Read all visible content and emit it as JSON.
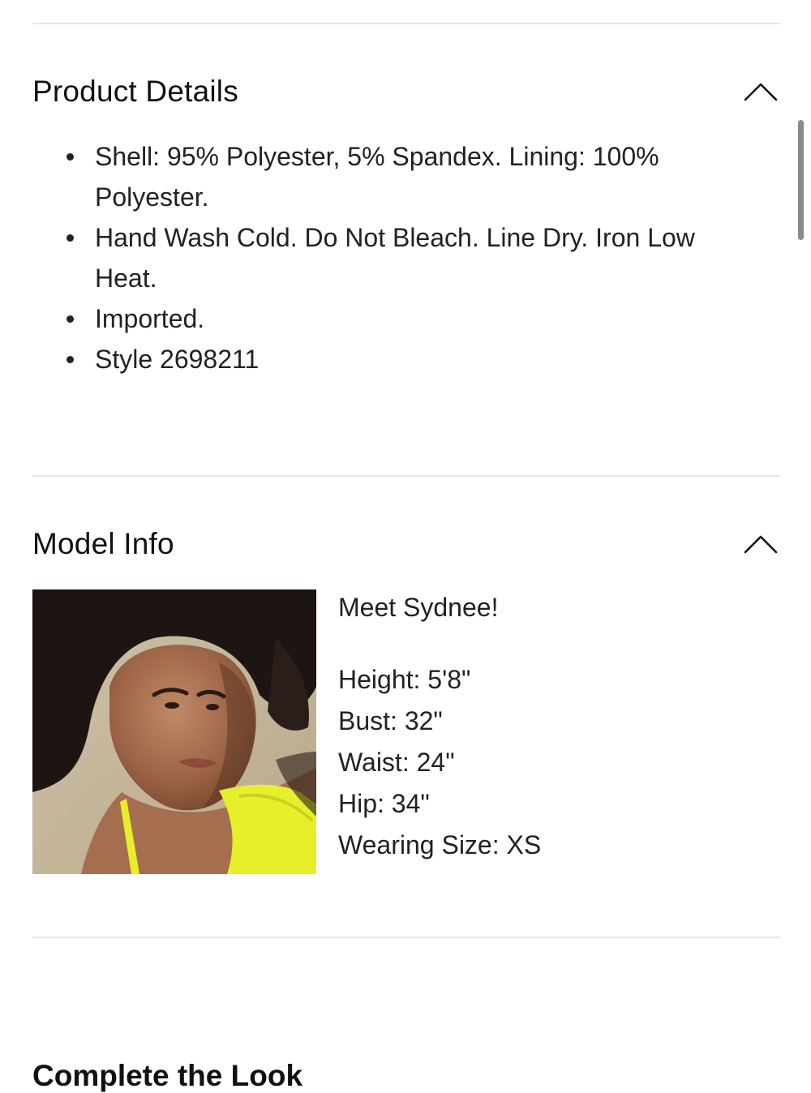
{
  "product_details": {
    "title": "Product Details",
    "toggle_icon": "chevron-up-icon",
    "items": [
      "Shell: 95% Polyester, 5% Spandex. Lining: 100% Polyester.",
      "Hand Wash Cold. Do Not Bleach. Line Dry. Iron Low Heat.",
      "Imported.",
      "Style 2698211"
    ]
  },
  "model_info": {
    "title": "Model Info",
    "toggle_icon": "chevron-up-icon",
    "photo_icon": "model-photo",
    "greeting": "Meet Sydnee!",
    "stats": [
      "Height: 5'8\"",
      "Bust: 32\"",
      "Waist: 24\"",
      "Hip: 34\"",
      "Wearing Size: XS"
    ]
  },
  "complete_the_look": {
    "title": "Complete the Look"
  },
  "colors": {
    "divider": "#e6e6e6",
    "text": "#222222",
    "swimsuit": "#e6f02a"
  }
}
